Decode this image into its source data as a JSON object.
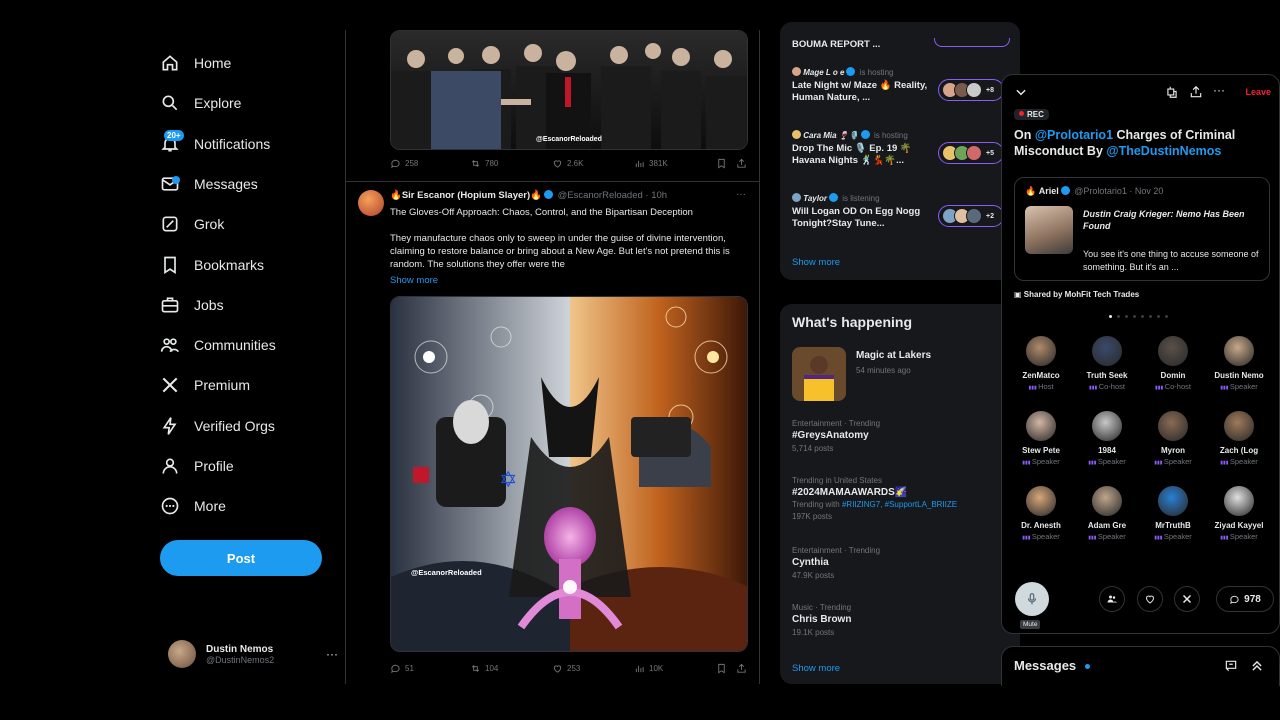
{
  "nav": {
    "items": [
      {
        "label": "Home",
        "icon": "home-icon"
      },
      {
        "label": "Explore",
        "icon": "search-icon"
      },
      {
        "label": "Notifications",
        "icon": "bell-icon",
        "badge": "20+"
      },
      {
        "label": "Messages",
        "icon": "mail-icon"
      },
      {
        "label": "Grok",
        "icon": "grok-icon"
      },
      {
        "label": "Bookmarks",
        "icon": "bookmark-icon"
      },
      {
        "label": "Jobs",
        "icon": "briefcase-icon"
      },
      {
        "label": "Communities",
        "icon": "people-icon"
      },
      {
        "label": "Premium",
        "icon": "x-logo-icon"
      },
      {
        "label": "Verified Orgs",
        "icon": "lightning-icon"
      },
      {
        "label": "Profile",
        "icon": "person-icon"
      },
      {
        "label": "More",
        "icon": "more-circle-icon"
      }
    ],
    "post_label": "Post",
    "account": {
      "name": "Dustin Nemos",
      "handle": "@DustinNemos2"
    }
  },
  "feed": {
    "tweet1": {
      "image_watermark": "@EscanorReloaded",
      "replies": "258",
      "reposts": "780",
      "likes": "2.6K",
      "views": "381K"
    },
    "tweet2": {
      "name": "🔥Sir Escanor (Hopium Slayer)🔥",
      "handle": "@EscanorReloaded",
      "time": "· 10h",
      "line1": "The Gloves-Off Approach: Chaos, Control, and the Bipartisan Deception",
      "line2": "They manufacture chaos only to sweep in under the guise of divine intervention, claiming to restore  balance or bring about a New Age. But let's not pretend this is random. The solutions they offer were the",
      "show_more": "Show more",
      "image_watermark": "@EscanorReloaded",
      "replies": "51",
      "reposts": "104",
      "likes": "253",
      "views": "10K"
    }
  },
  "spaces": {
    "top_title": "BOUMA REPORT ...",
    "list": [
      {
        "host": "Mage L o e",
        "status": "is hosting",
        "title": "Late Night w/ Maze 🔥 Reality, Human Nature, ...",
        "count": "+8"
      },
      {
        "host": "Cara Mia 🍷🎙️",
        "status": "is hosting",
        "title": "Drop The Mic 🎙️ Ep. 19 🌴 Havana Nights 🕺💃🌴...",
        "count": "+5"
      },
      {
        "host": "Taylor",
        "status": "is listening",
        "title": "Will Logan OD On Egg Nogg Tonight?Stay Tune...",
        "count": "+2"
      }
    ],
    "show_more": "Show more"
  },
  "happening": {
    "title": "What's happening",
    "event": {
      "name": "Magic at Lakers",
      "time": "54 minutes ago"
    },
    "trends": [
      {
        "category": "Entertainment · Trending",
        "name": "#GreysAnatomy",
        "posts": "5,714 posts"
      },
      {
        "category": "Trending in United States",
        "name": "#2024MAMAAWARDS🌠",
        "with_prefix": "Trending with",
        "with_tags": "#RIIZING7, #SupportLA_BRIIZE",
        "posts": "197K posts"
      },
      {
        "category": "Entertainment · Trending",
        "name": "Cynthia",
        "posts": "47.9K posts"
      },
      {
        "category": "Music · Trending",
        "name": "Chris Brown",
        "posts": "19.1K posts"
      }
    ],
    "show_more": "Show more"
  },
  "space_panel": {
    "leave_label": "Leave",
    "rec_label": "REC",
    "heading_prefix": "On ",
    "heading_mention1": "@Prolotario1",
    "heading_middle": " Charges of Criminal Misconduct By ",
    "heading_mention2": "@TheDustinNemos",
    "shared": {
      "name": "Ariel",
      "handle": "@Prolotario1 · Nov 20",
      "title": "Dustin Craig Krieger: Nemo Has Been Found",
      "body": "You see it's one thing to accuse someone of something. But it's an ..."
    },
    "shared_by": "Shared by MohFit Tech Trades",
    "speakers": [
      {
        "name": "ZenMatco",
        "role": "Host",
        "color": "#b08a6a"
      },
      {
        "name": "Truth Seek",
        "role": "Co-host",
        "color": "#3b4a6b"
      },
      {
        "name": "Domin",
        "role": "Co-host",
        "color": "#5a5048"
      },
      {
        "name": "Dustin Nemo",
        "role": "Speaker",
        "color": "#c9a88a"
      },
      {
        "name": "Stew Pete",
        "role": "Speaker",
        "color": "#d2b6a4"
      },
      {
        "name": "1984",
        "role": "Speaker",
        "color": "#c8c8c8"
      },
      {
        "name": "Myron",
        "role": "Speaker",
        "color": "#8a6a55"
      },
      {
        "name": "Zach (Log",
        "role": "Speaker",
        "color": "#a07a5a"
      },
      {
        "name": "Dr. Anesth",
        "role": "Speaker",
        "color": "#d8a77a"
      },
      {
        "name": "Adam Gre",
        "role": "Speaker",
        "color": "#bfa58c"
      },
      {
        "name": "MrTruthB",
        "role": "Speaker",
        "color": "#2a7fd4"
      },
      {
        "name": "Ziyad Kayyel",
        "role": "Speaker",
        "color": "#e0e0e0"
      }
    ],
    "mute_label": "Mute",
    "comments": "978"
  },
  "messages_bar": {
    "title": "Messages"
  }
}
